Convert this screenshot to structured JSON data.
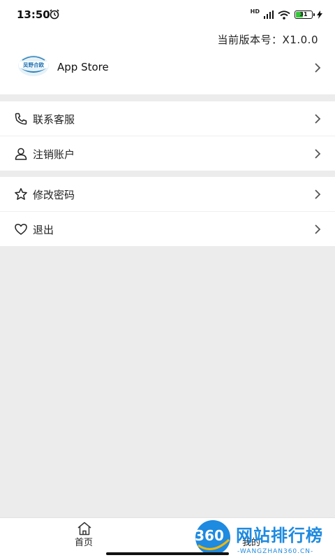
{
  "status_bar": {
    "time": "13:50",
    "network_badge": "HD",
    "battery_level": "31"
  },
  "header": {
    "version_label": "当前版本号：X1.0.0"
  },
  "app_store": {
    "label": "App Store",
    "logo_text": "吴野合欧"
  },
  "menu_groups": [
    {
      "items": [
        {
          "label": "联系客服",
          "icon": "phone-icon"
        },
        {
          "label": "注销账户",
          "icon": "user-icon"
        }
      ]
    },
    {
      "items": [
        {
          "label": "修改密码",
          "icon": "star-icon"
        },
        {
          "label": "退出",
          "icon": "heart-icon"
        }
      ]
    }
  ],
  "bottom_nav": {
    "tabs": [
      {
        "label": "首页",
        "icon": "home-icon"
      },
      {
        "label": "我的"
      }
    ]
  },
  "watermark": {
    "circle_text": "360",
    "title": "网站排行榜",
    "subtitle": "-WANGZHAN360.CN-"
  },
  "colors": {
    "accent": "#1e8ae0",
    "page_background": "#ececec",
    "battery_fill": "#35c63a"
  }
}
